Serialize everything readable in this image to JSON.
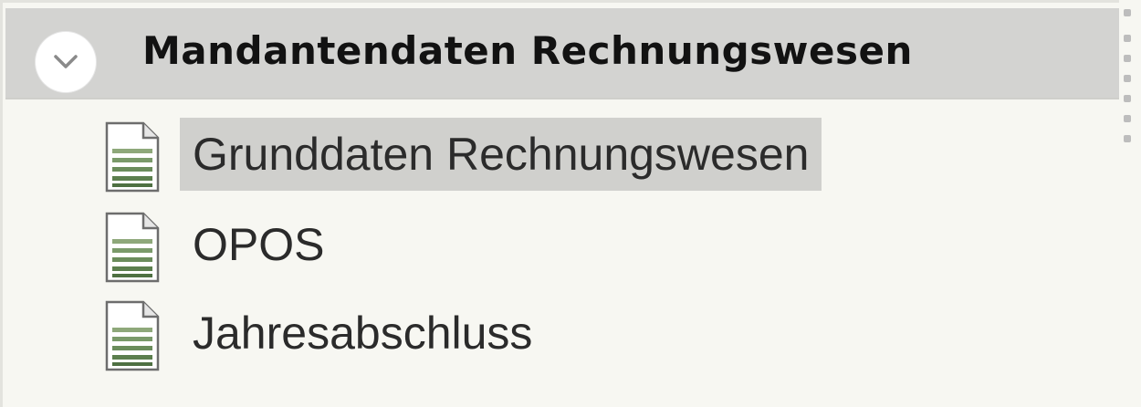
{
  "group": {
    "title": "Mandantendaten Rechnungswesen",
    "expanded": true,
    "toggle_icon": "chevron-down-icon",
    "items": [
      {
        "label": "Grunddaten Rechnungswesen",
        "icon": "document-icon",
        "selected": true
      },
      {
        "label": "OPOS",
        "icon": "document-icon",
        "selected": false
      },
      {
        "label": "Jahresabschluss",
        "icon": "document-icon",
        "selected": false
      }
    ]
  },
  "colors": {
    "panel_background": "#f7f7f2",
    "header_background": "#d3d3d1",
    "selection_background": "#d0d0cd",
    "icon_stripes": "#7a9a6a"
  }
}
